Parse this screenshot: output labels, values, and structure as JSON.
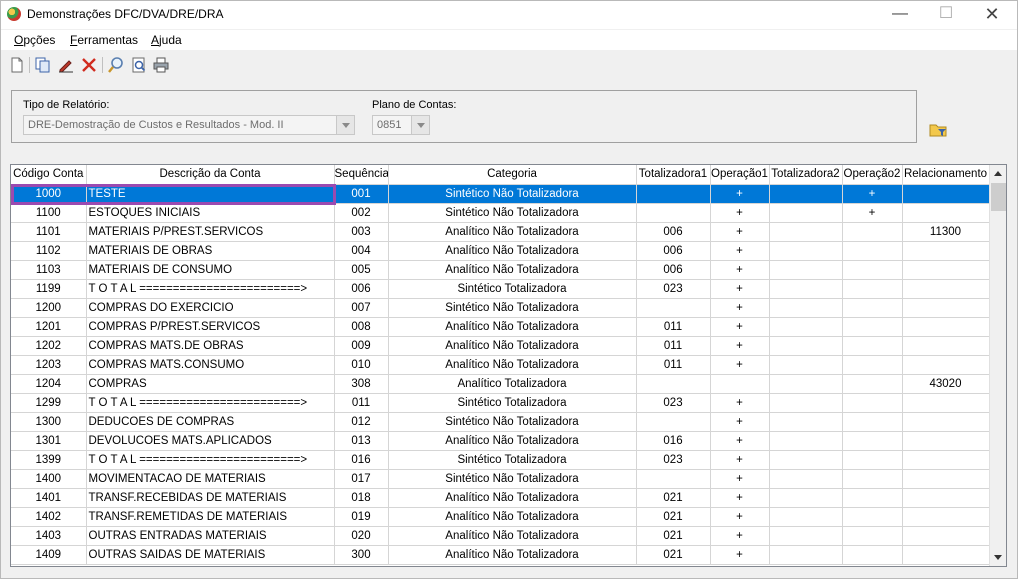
{
  "window": {
    "title": "Demonstrações DFC/DVA/DRE/DRA"
  },
  "menu": [
    {
      "label": "Opções",
      "accel": "O",
      "rest": "pções"
    },
    {
      "label": "Ferramentas",
      "accel": "F",
      "rest": "erramentas"
    },
    {
      "label": "Ajuda",
      "accel": "A",
      "rest": "juda"
    }
  ],
  "toolbar": [
    {
      "name": "new-document-icon"
    },
    {
      "name": "copy-icon"
    },
    {
      "name": "edit-pen-icon"
    },
    {
      "name": "delete-x-icon"
    },
    {
      "name": "search-icon"
    },
    {
      "name": "preview-icon"
    },
    {
      "name": "print-icon"
    }
  ],
  "filters": {
    "report_type_label": "Tipo de Relatório:",
    "report_type_value": "DRE-Demostração de Custos e Resultados - Mod. II",
    "chart_label": "Plano de Contas:",
    "chart_value": "0851"
  },
  "grid": {
    "columns": [
      "Código Conta",
      "Descrição da Conta",
      "Sequência",
      "Categoria",
      "Totalizadora1",
      "Operação1",
      "Totalizadora2",
      "Operação2",
      "Relacionamento"
    ],
    "rows": [
      [
        "1000",
        "TESTE",
        "001",
        "Sintético Não Totalizadora",
        "",
        "+",
        "",
        "+",
        ""
      ],
      [
        "1100",
        "ESTOQUES INICIAIS",
        "002",
        "Sintético Não Totalizadora",
        "",
        "+",
        "",
        "+",
        ""
      ],
      [
        "1101",
        "MATERIAIS P/PREST.SERVICOS",
        "003",
        "Analítico Não Totalizadora",
        "006",
        "+",
        "",
        "",
        "11300"
      ],
      [
        "1102",
        "MATERIAIS DE OBRAS",
        "004",
        "Analítico Não Totalizadora",
        "006",
        "+",
        "",
        "",
        ""
      ],
      [
        "1103",
        "MATERIAIS DE CONSUMO",
        "005",
        "Analítico Não Totalizadora",
        "006",
        "+",
        "",
        "",
        ""
      ],
      [
        "1199",
        "T O T A L ========================>",
        "006",
        "Sintético Totalizadora",
        "023",
        "+",
        "",
        "",
        ""
      ],
      [
        "1200",
        "COMPRAS DO EXERCICIO",
        "007",
        "Sintético Não Totalizadora",
        "",
        "+",
        "",
        "",
        ""
      ],
      [
        "1201",
        "COMPRAS P/PREST.SERVICOS",
        "008",
        "Analítico Não Totalizadora",
        "011",
        "+",
        "",
        "",
        ""
      ],
      [
        "1202",
        "COMPRAS MATS.DE OBRAS",
        "009",
        "Analítico Não Totalizadora",
        "011",
        "+",
        "",
        "",
        ""
      ],
      [
        "1203",
        "COMPRAS MATS.CONSUMO",
        "010",
        "Analítico Não Totalizadora",
        "011",
        "+",
        "",
        "",
        ""
      ],
      [
        "1204",
        "COMPRAS",
        "308",
        "Analítico Totalizadora",
        "",
        "",
        "",
        "",
        "43020"
      ],
      [
        "1299",
        "T O T A L ========================>",
        "011",
        "Sintético Totalizadora",
        "023",
        "+",
        "",
        "",
        ""
      ],
      [
        "1300",
        "DEDUCOES DE COMPRAS",
        "012",
        "Sintético Não Totalizadora",
        "",
        "+",
        "",
        "",
        ""
      ],
      [
        "1301",
        "DEVOLUCOES MATS.APLICADOS",
        "013",
        "Analítico Não Totalizadora",
        "016",
        "+",
        "",
        "",
        ""
      ],
      [
        "1399",
        "T O T A L ========================>",
        "016",
        "Sintético Totalizadora",
        "023",
        "+",
        "",
        "",
        ""
      ],
      [
        "1400",
        "MOVIMENTACAO DE MATERIAIS",
        "017",
        "Sintético Não Totalizadora",
        "",
        "+",
        "",
        "",
        ""
      ],
      [
        "1401",
        "TRANSF.RECEBIDAS DE MATERIAIS",
        "018",
        "Analítico Não Totalizadora",
        "021",
        "+",
        "",
        "",
        ""
      ],
      [
        "1402",
        "TRANSF.REMETIDAS DE MATERIAIS",
        "019",
        "Analítico Não Totalizadora",
        "021",
        "+",
        "",
        "",
        ""
      ],
      [
        "1403",
        "OUTRAS ENTRADAS MATERIAIS",
        "020",
        "Analítico Não Totalizadora",
        "021",
        "+",
        "",
        "",
        ""
      ],
      [
        "1409",
        "OUTRAS SAIDAS DE MATERIAIS",
        "300",
        "Analítico Não Totalizadora",
        "021",
        "+",
        "",
        "",
        ""
      ]
    ],
    "selected_row": 0
  },
  "colors": {
    "selection": "#0078d7",
    "highlight_outline": "#9b4ab0"
  }
}
